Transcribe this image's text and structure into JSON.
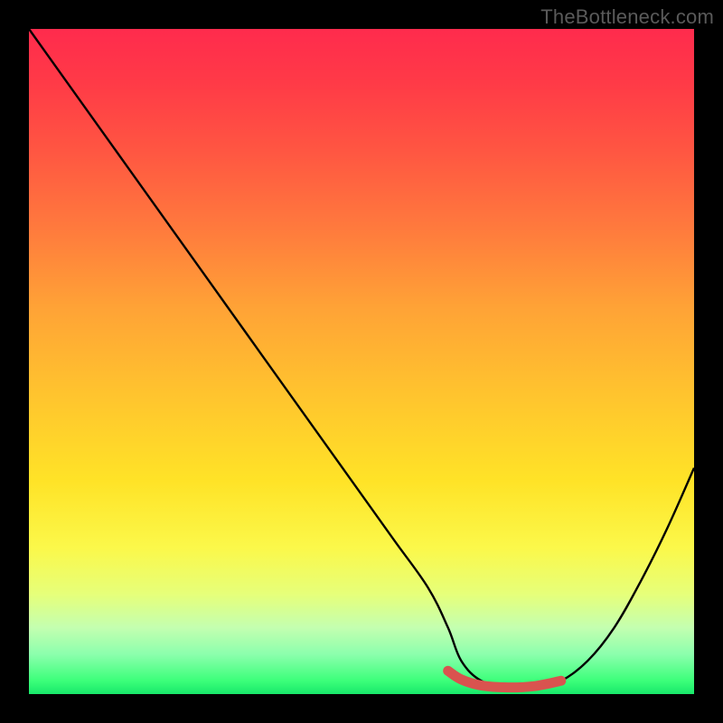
{
  "watermark": "TheBottleneck.com",
  "colors": {
    "page_bg": "#000000",
    "watermark_text": "#5a5a5a",
    "curve_stroke": "#000000",
    "marker_stroke": "#d9534f",
    "gradient_stops": [
      "#ff2b4d",
      "#ff3a47",
      "#ff5542",
      "#ff7a3d",
      "#ffa336",
      "#ffc42e",
      "#ffe327",
      "#fbf84a",
      "#e6ff7a",
      "#c4ffb0",
      "#8cffad",
      "#3cff7a",
      "#18e86a"
    ]
  },
  "chart_data": {
    "type": "line",
    "title": "",
    "xlabel": "",
    "ylabel": "",
    "xlim": [
      0,
      100
    ],
    "ylim": [
      0,
      100
    ],
    "grid": false,
    "legend": false,
    "series": [
      {
        "name": "bottleneck-curve",
        "x": [
          0,
          5,
          10,
          15,
          20,
          25,
          30,
          35,
          40,
          45,
          50,
          55,
          60,
          63,
          65,
          68,
          72,
          76,
          80,
          84,
          88,
          92,
          96,
          100
        ],
        "y": [
          100,
          93,
          86,
          79,
          72,
          65,
          58,
          51,
          44,
          37,
          30,
          23,
          16,
          10,
          5,
          2,
          1,
          1,
          2,
          5,
          10,
          17,
          25,
          34
        ]
      }
    ],
    "marker_segment": {
      "name": "highlighted-range",
      "x": [
        63,
        65,
        68,
        72,
        76,
        80
      ],
      "y": [
        3.5,
        2.2,
        1.3,
        1.0,
        1.2,
        2.0
      ]
    },
    "notes": "Axes are unlabeled; y interpreted as bottleneck percentage (higher = worse). Background gradient encodes the same scale (red = high, green = low)."
  }
}
